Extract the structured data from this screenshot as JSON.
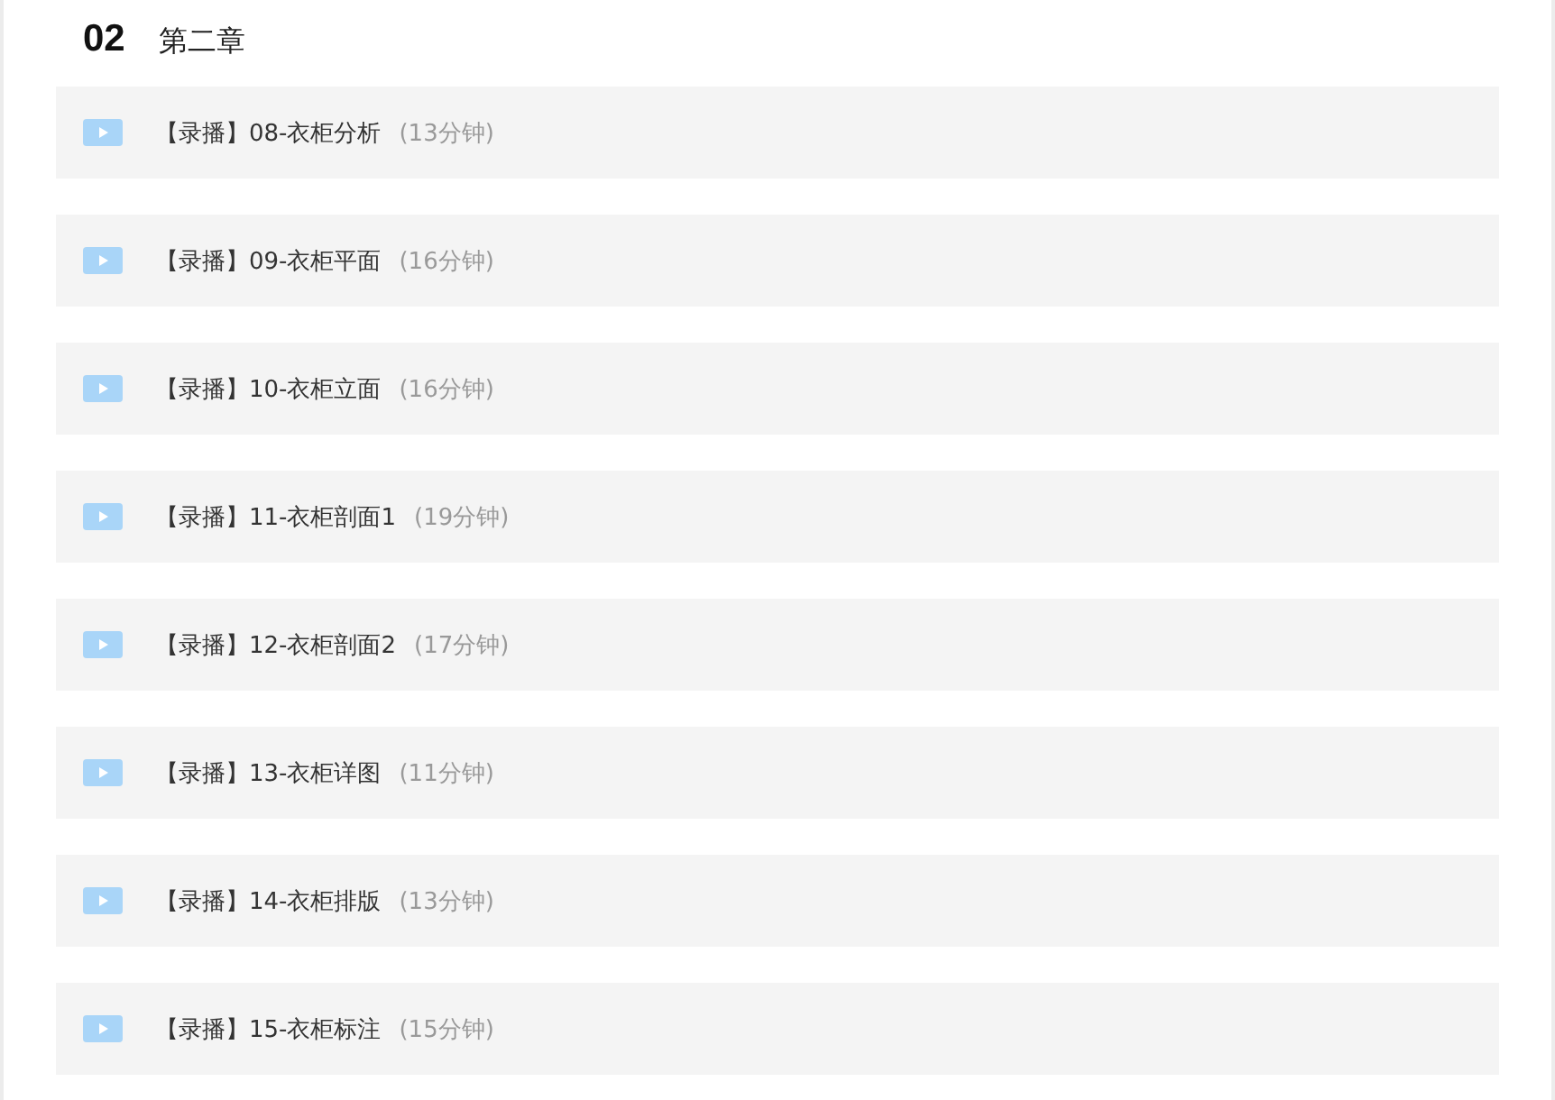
{
  "chapter": {
    "number": "02",
    "title": "第二章"
  },
  "lessons": [
    {
      "title": "【录播】08-衣柜分析",
      "duration": "(13分钟)"
    },
    {
      "title": "【录播】09-衣柜平面",
      "duration": "(16分钟)"
    },
    {
      "title": "【录播】10-衣柜立面",
      "duration": "(16分钟)"
    },
    {
      "title": "【录播】11-衣柜剖面1",
      "duration": "(19分钟)"
    },
    {
      "title": "【录播】12-衣柜剖面2",
      "duration": "(17分钟)"
    },
    {
      "title": "【录播】13-衣柜详图",
      "duration": "(11分钟)"
    },
    {
      "title": "【录播】14-衣柜排版",
      "duration": "(13分钟)"
    },
    {
      "title": "【录播】15-衣柜标注",
      "duration": "(15分钟)"
    }
  ]
}
